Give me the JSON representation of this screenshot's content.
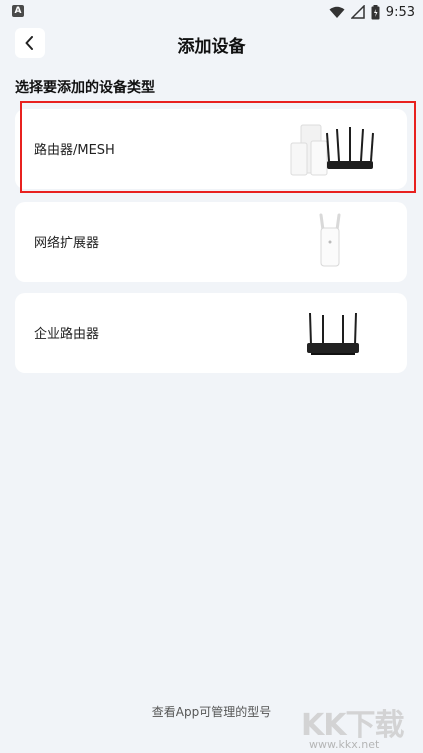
{
  "status_bar": {
    "notification_icon": "A",
    "time": "9:53",
    "icons": [
      "wifi-icon",
      "signal-icon",
      "battery-icon"
    ]
  },
  "header": {
    "title": "添加设备",
    "back_icon": "chevron-left-icon"
  },
  "section_label": "选择要添加的设备类型",
  "device_types": [
    {
      "label": "路由器/MESH",
      "image": "router-mesh-image",
      "selected": true
    },
    {
      "label": "网络扩展器",
      "image": "extender-image",
      "selected": false
    },
    {
      "label": "企业路由器",
      "image": "enterprise-router-image",
      "selected": false
    }
  ],
  "footer": {
    "link": "查看App可管理的型号"
  },
  "watermark": {
    "brand": "KK下载",
    "url": "www.kkx.net"
  },
  "colors": {
    "background": "#f1f4f8",
    "card": "#ffffff",
    "highlight": "#e8211f"
  }
}
